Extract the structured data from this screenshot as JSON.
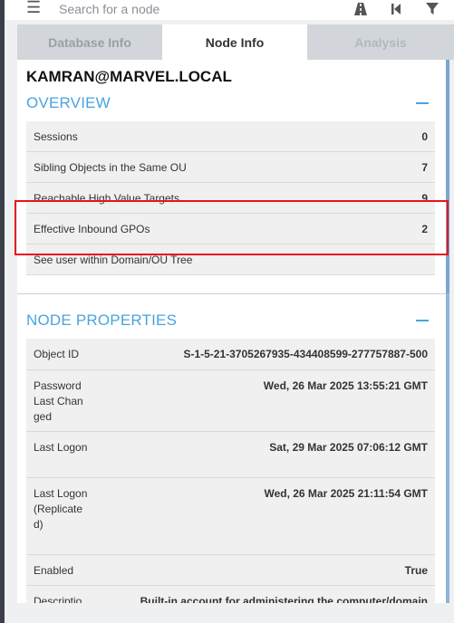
{
  "search": {
    "placeholder": "Search for a node"
  },
  "toolbar": {
    "menu_icon": "hamburger-icon",
    "path_icon": "road-icon",
    "back_icon": "step-backward-icon",
    "filter_icon": "filter-icon"
  },
  "tabs": [
    {
      "label": "Database Info",
      "active": false
    },
    {
      "label": "Node Info",
      "active": true
    },
    {
      "label": "Analysis",
      "active": false
    }
  ],
  "node": {
    "name": "KAMRAN@MARVEL.LOCAL"
  },
  "overview": {
    "title": "OVERVIEW",
    "rows": [
      {
        "label": "Sessions",
        "value": "0"
      },
      {
        "label": "Sibling Objects in the Same OU",
        "value": "7"
      },
      {
        "label": "Reachable High Value Targets",
        "value": "9"
      },
      {
        "label": "Effective Inbound GPOs",
        "value": "2"
      },
      {
        "label": "See user within Domain/OU Tree",
        "value": ""
      }
    ]
  },
  "node_properties": {
    "title": "NODE PROPERTIES",
    "rows": [
      {
        "label": "Object ID",
        "value": "S-1-5-21-3705267935-434408599-277757887-500"
      },
      {
        "label": "Password Last Changed",
        "value": "Wed, 26 Mar 2025 13:55:21 GMT"
      },
      {
        "label": "Last Logon",
        "value": "Sat, 29 Mar 2025 07:06:12 GMT"
      },
      {
        "label": "Last Logon (Replicated)",
        "value": "Wed, 26 Mar 2025 21:11:54 GMT"
      },
      {
        "label": "Enabled",
        "value": "True"
      },
      {
        "label": "Description",
        "value": "Built-in account for administering the computer/domain"
      }
    ]
  },
  "colors": {
    "accent": "#4aa3df",
    "highlight": "#e8141a",
    "panel_bg": "#ffffff",
    "row_bg": "#f0f0f0"
  }
}
